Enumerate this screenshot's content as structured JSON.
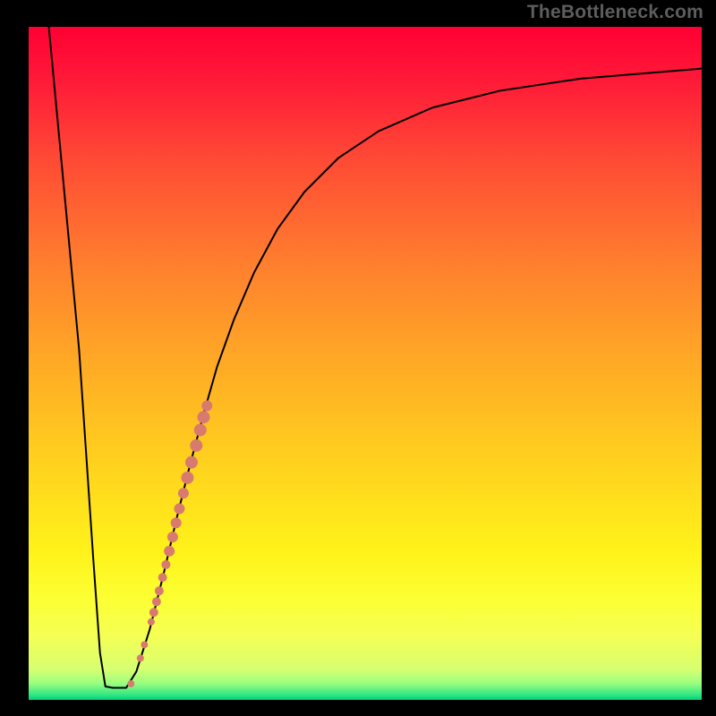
{
  "watermark": "TheBottleneck.com",
  "chart_data": {
    "type": "line",
    "title": "",
    "xlabel": "",
    "ylabel": "",
    "xlim": [
      0,
      100
    ],
    "ylim": [
      0,
      100
    ],
    "grid": false,
    "legend_position": "none",
    "gradient_stops": [
      {
        "pos": 0.0,
        "color": "#ff0033"
      },
      {
        "pos": 0.08,
        "color": "#ff1a38"
      },
      {
        "pos": 0.2,
        "color": "#ff4b35"
      },
      {
        "pos": 0.35,
        "color": "#ff7e2e"
      },
      {
        "pos": 0.5,
        "color": "#ffaa25"
      },
      {
        "pos": 0.65,
        "color": "#ffd21e"
      },
      {
        "pos": 0.78,
        "color": "#fff21a"
      },
      {
        "pos": 0.85,
        "color": "#fcff33"
      },
      {
        "pos": 0.905,
        "color": "#f5ff55"
      },
      {
        "pos": 0.955,
        "color": "#d6ff70"
      },
      {
        "pos": 0.975,
        "color": "#9cff80"
      },
      {
        "pos": 0.992,
        "color": "#35e884"
      },
      {
        "pos": 1.0,
        "color": "#00d07a"
      }
    ],
    "series": [
      {
        "name": "bottleneck-curve",
        "color": "#000000",
        "points": [
          {
            "x": 3.0,
            "y": 100.0
          },
          {
            "x": 7.5,
            "y": 52.0
          },
          {
            "x": 9.6,
            "y": 21.0
          },
          {
            "x": 10.6,
            "y": 7.0
          },
          {
            "x": 11.4,
            "y": 2.0
          },
          {
            "x": 12.5,
            "y": 1.8
          },
          {
            "x": 14.5,
            "y": 1.8
          },
          {
            "x": 16.0,
            "y": 4.2
          },
          {
            "x": 18.0,
            "y": 10.5
          },
          {
            "x": 20.0,
            "y": 18.5
          },
          {
            "x": 22.0,
            "y": 27.0
          },
          {
            "x": 24.0,
            "y": 35.0
          },
          {
            "x": 26.0,
            "y": 42.5
          },
          {
            "x": 28.0,
            "y": 49.5
          },
          {
            "x": 30.5,
            "y": 56.5
          },
          {
            "x": 33.5,
            "y": 63.5
          },
          {
            "x": 37.0,
            "y": 70.0
          },
          {
            "x": 41.0,
            "y": 75.5
          },
          {
            "x": 46.0,
            "y": 80.5
          },
          {
            "x": 52.0,
            "y": 84.5
          },
          {
            "x": 60.0,
            "y": 88.0
          },
          {
            "x": 70.0,
            "y": 90.5
          },
          {
            "x": 82.0,
            "y": 92.3
          },
          {
            "x": 100.0,
            "y": 93.8
          }
        ]
      }
    ],
    "markers": {
      "name": "highlighted-points",
      "color": "#d97a6f",
      "points": [
        {
          "x": 15.2,
          "y": 2.4,
          "r": 4
        },
        {
          "x": 16.6,
          "y": 6.2,
          "r": 4
        },
        {
          "x": 17.2,
          "y": 8.2,
          "r": 4
        },
        {
          "x": 18.2,
          "y": 11.6,
          "r": 4
        },
        {
          "x": 18.6,
          "y": 13.0,
          "r": 5
        },
        {
          "x": 19.0,
          "y": 14.6,
          "r": 5
        },
        {
          "x": 19.4,
          "y": 16.2,
          "r": 5
        },
        {
          "x": 19.9,
          "y": 18.2,
          "r": 5
        },
        {
          "x": 20.4,
          "y": 20.1,
          "r": 5
        },
        {
          "x": 20.9,
          "y": 22.1,
          "r": 6
        },
        {
          "x": 21.4,
          "y": 24.2,
          "r": 6
        },
        {
          "x": 21.9,
          "y": 26.3,
          "r": 6
        },
        {
          "x": 22.4,
          "y": 28.4,
          "r": 6
        },
        {
          "x": 23.0,
          "y": 30.7,
          "r": 6
        },
        {
          "x": 23.6,
          "y": 33.0,
          "r": 7
        },
        {
          "x": 24.2,
          "y": 35.3,
          "r": 7
        },
        {
          "x": 24.9,
          "y": 37.8,
          "r": 7
        },
        {
          "x": 25.5,
          "y": 40.1,
          "r": 7
        },
        {
          "x": 26.0,
          "y": 42.0,
          "r": 7
        },
        {
          "x": 26.5,
          "y": 43.7,
          "r": 6
        }
      ]
    },
    "ticks": {
      "x_relative": [
        0.06,
        0.165,
        0.27,
        0.375,
        0.48,
        0.585,
        0.69,
        0.795,
        0.9
      ],
      "y_relative": [
        0.1,
        0.205,
        0.31,
        0.415,
        0.52,
        0.625,
        0.73,
        0.835,
        0.94
      ]
    }
  }
}
